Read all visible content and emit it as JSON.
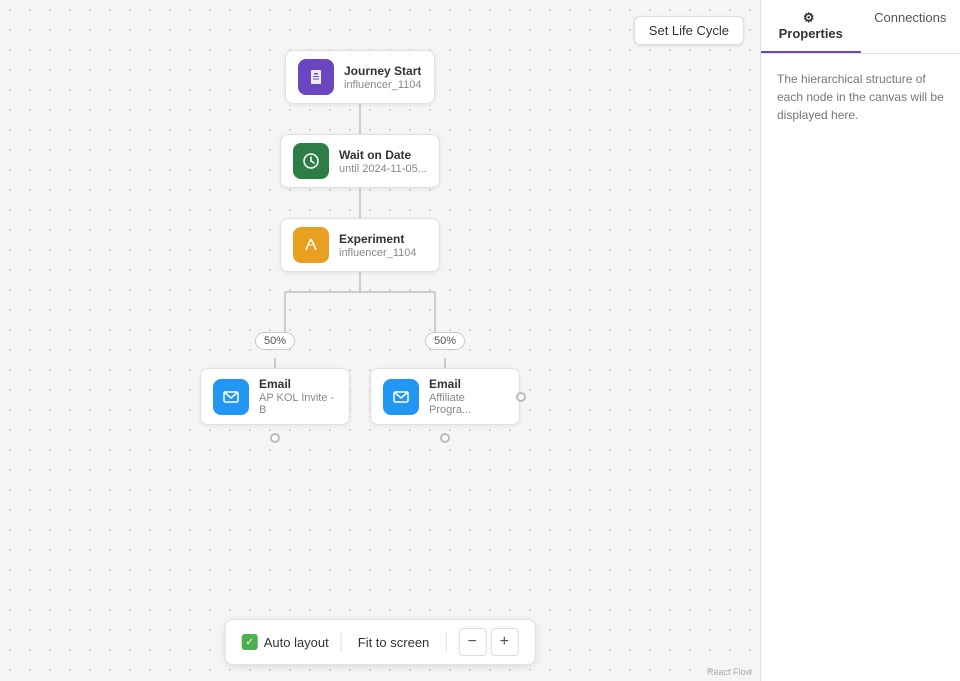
{
  "toolbar": {
    "set_lifecycle_label": "Set Life Cycle"
  },
  "right_panel": {
    "tab_properties_label": "Properties",
    "tab_connections_label": "Connections",
    "properties_icon": "⚙",
    "empty_message": "The hierarchical structure of each node in the canvas will be displayed here."
  },
  "nodes": {
    "journey_start": {
      "title": "Journey Start",
      "subtitle": "influencer_1104",
      "icon_type": "purple",
      "icon_symbol": "▣"
    },
    "wait_on_date": {
      "title": "Wait on Date",
      "subtitle": "until 2024-11-05...",
      "icon_type": "green",
      "icon_symbol": "⏱"
    },
    "experiment": {
      "title": "Experiment",
      "subtitle": "influencer_1104",
      "icon_type": "orange",
      "icon_symbol": "⚗"
    },
    "email_left": {
      "title": "Email",
      "subtitle": "AP KOL Invite - B",
      "icon_type": "blue",
      "icon_symbol": "✉"
    },
    "email_right": {
      "title": "Email",
      "subtitle": "Affiliate Progra...",
      "icon_type": "blue",
      "icon_symbol": "✉"
    }
  },
  "branches": {
    "left_percent": "50%",
    "right_percent": "50%"
  },
  "bottom_toolbar": {
    "auto_layout_label": "Auto layout",
    "fit_screen_label": "Fit to screen",
    "zoom_minus_label": "−",
    "zoom_plus_label": "+"
  },
  "watermark": {
    "label": "React Flow"
  }
}
